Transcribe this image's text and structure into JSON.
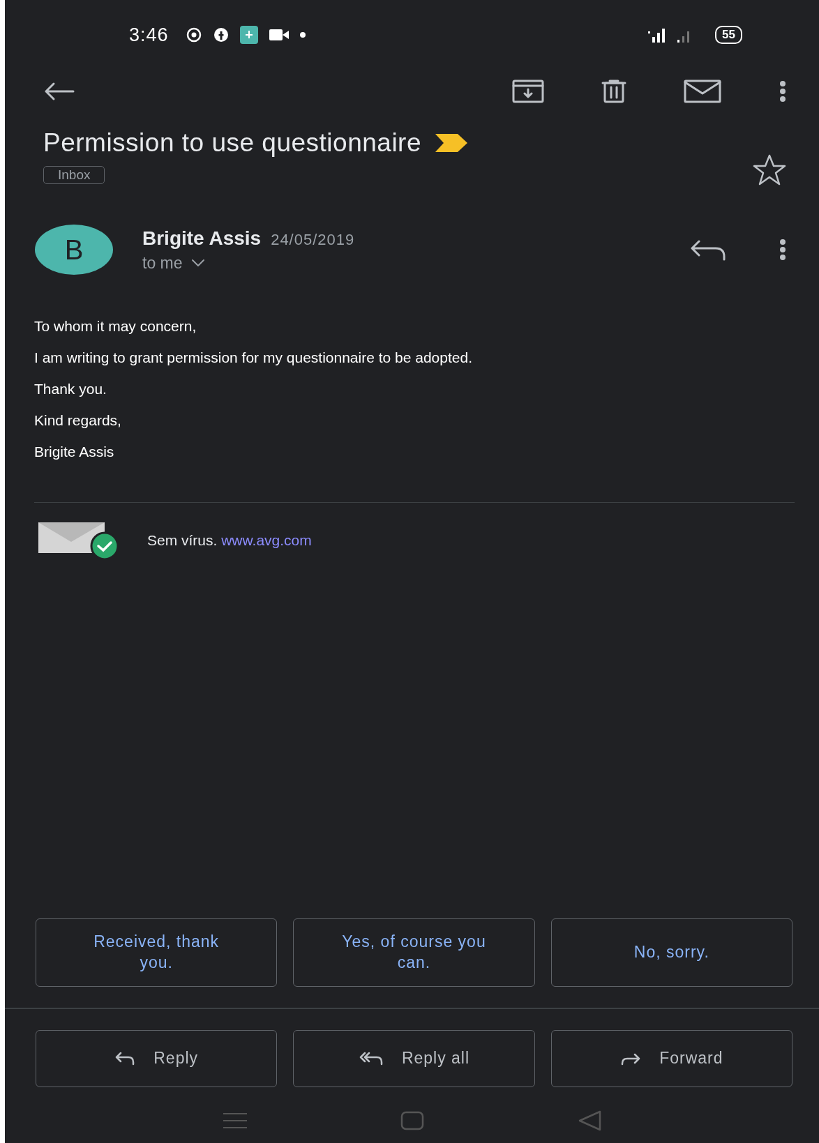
{
  "status_bar": {
    "time": "3:46",
    "battery": "55"
  },
  "email": {
    "subject": "Permission to use questionnaire",
    "important": true,
    "starred": false,
    "label": "Inbox",
    "sender": {
      "initial": "B",
      "name": "Brigite Assis",
      "date": "24/05/2019",
      "recipient": "to me"
    },
    "body": [
      "To whom it may concern,",
      "I am writing to grant permission for my questionnaire to be adopted.",
      "Thank you.",
      "Kind regards,",
      "Brigite Assis"
    ],
    "signature": {
      "text": "Sem vírus.",
      "link": "www.avg.com"
    }
  },
  "smart_replies": [
    "Received, thank you.",
    "Yes, of course you can.",
    "No, sorry."
  ],
  "actions": [
    {
      "kind": "reply",
      "label": "Reply"
    },
    {
      "kind": "reply_all",
      "label": "Reply all"
    },
    {
      "kind": "forward",
      "label": "Forward"
    }
  ]
}
